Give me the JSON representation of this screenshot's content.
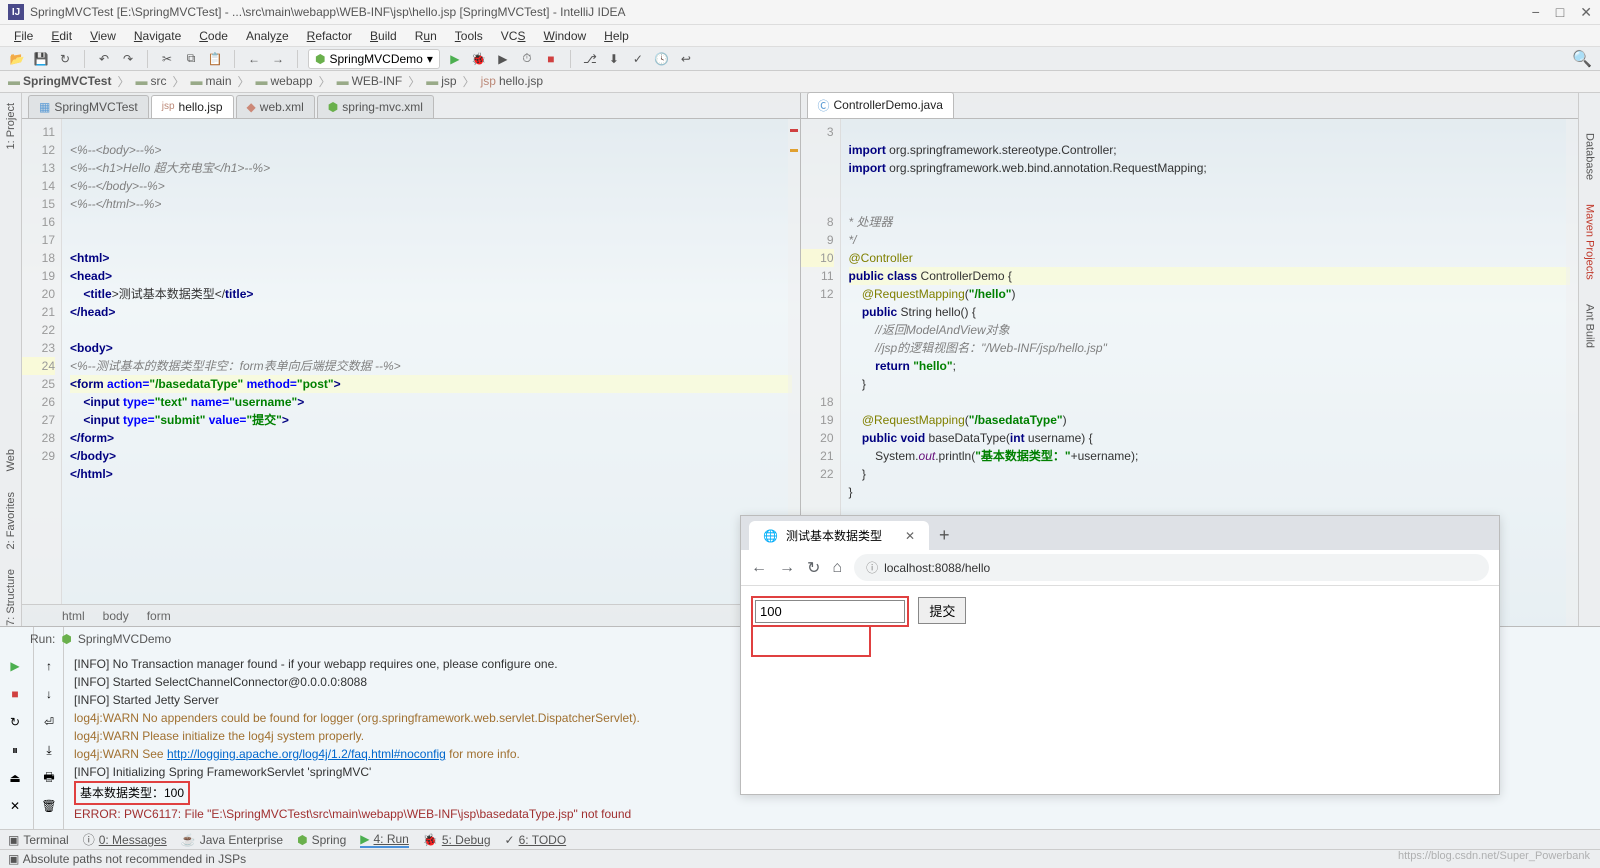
{
  "titlebar": {
    "text": "SpringMVCTest [E:\\SpringMVCTest] - ...\\src\\main\\webapp\\WEB-INF\\jsp\\hello.jsp [SpringMVCTest] - IntelliJ IDEA"
  },
  "menu": [
    "File",
    "Edit",
    "View",
    "Navigate",
    "Code",
    "Analyze",
    "Refactor",
    "Build",
    "Run",
    "Tools",
    "VCS",
    "Window",
    "Help"
  ],
  "run_config": "SpringMVCDemo",
  "breadcrumbs": [
    "SpringMVCTest",
    "src",
    "main",
    "webapp",
    "WEB-INF",
    "jsp",
    "hello.jsp"
  ],
  "left_tabs": [
    {
      "label": "SpringMVCTest",
      "active": false
    },
    {
      "label": "hello.jsp",
      "active": true
    },
    {
      "label": "web.xml",
      "active": false
    },
    {
      "label": "spring-mvc.xml",
      "active": false
    }
  ],
  "right_tabs": [
    {
      "label": "ControllerDemo.java",
      "active": true
    }
  ],
  "left_rail": [
    "1: Project",
    "Web",
    "2: Favorites",
    "7: Structure"
  ],
  "right_rail": [
    "Database",
    "Maven Projects",
    "Ant Build"
  ],
  "left_gutter": [
    "11",
    "12",
    "13",
    "14",
    "15",
    "16",
    "17",
    "18",
    "19",
    "20",
    "21",
    "22",
    "23",
    "24",
    "25",
    "26",
    "27",
    "28",
    "29"
  ],
  "right_gutter": [
    "3",
    "",
    "",
    "",
    "",
    "8",
    "9",
    "10",
    "11",
    "12",
    "",
    "",
    "",
    "",
    "",
    "18",
    "19",
    "20",
    "21",
    "22"
  ],
  "crumbs_bottom": [
    "html",
    "body",
    "form"
  ],
  "run": {
    "label": "Run:",
    "config": "SpringMVCDemo",
    "lines": {
      "l1": "[INFO] No Transaction manager found - if your webapp requires one, please configure one.",
      "l2": "[INFO] Started SelectChannelConnector@0.0.0.0:8088",
      "l3": "[INFO] Started Jetty Server",
      "l4": "log4j:WARN No appenders could be found for logger (org.springframework.web.servlet.DispatcherServlet).",
      "l5": "log4j:WARN Please initialize the log4j system properly.",
      "l6a": "log4j:WARN See ",
      "l6b": "http://logging.apache.org/log4j/1.2/faq.html#noconfig",
      "l6c": " for more info.",
      "l7": "[INFO] Initializing Spring FrameworkServlet 'springMVC'",
      "l8": "基本数据类型：100",
      "l9": "ERROR: PWC6117: File \"E:\\SpringMVCTest\\src\\main\\webapp\\WEB-INF\\jsp\\basedataType.jsp\" not found"
    }
  },
  "bottom_tabs": [
    "Terminal",
    "0: Messages",
    "Java Enterprise",
    "Spring",
    "4: Run",
    "5: Debug",
    "6: TODO"
  ],
  "statusbar": "Absolute paths not recommended in JSPs",
  "browser": {
    "tab_title": "测试基本数据类型",
    "url": "localhost:8088/hello",
    "input_value": "100",
    "submit_label": "提交"
  },
  "left_code": {
    "c11": "<%--<body>--%>",
    "c12": "<%--<h1>Hello 超大充电宝</h1>--%>",
    "c13": "<%--</body>--%>",
    "c14": "<%--</html>--%>",
    "c17_open": "<",
    "c17_tag": "html",
    "c17_close": ">",
    "c18_open": "<",
    "c18_tag": "head",
    "c18_close": ">",
    "c19_open": "    <",
    "c19_tag": "title",
    "c19_mid": ">测试基本数据类型</",
    "c19_tag2": "title",
    "c19_close": ">",
    "c20_open": "</",
    "c20_tag": "head",
    "c20_close": ">",
    "c22_open": "<",
    "c22_tag": "body",
    "c22_close": ">",
    "c23": "<%--测试基本的数据类型非空：form表单向后端提交数据 --%>",
    "c24_open": "<",
    "c24_tag": "form ",
    "c24_a1": "action=",
    "c24_v1": "\"/basedataType\"",
    "c24_a2": " method=",
    "c24_v2": "\"post\"",
    "c24_close": ">",
    "c25_open": "    <",
    "c25_tag": "input ",
    "c25_a1": "type=",
    "c25_v1": "\"text\"",
    "c25_a2": " name=",
    "c25_v2": "\"username\"",
    "c25_close": ">",
    "c26_open": "    <",
    "c26_tag": "input ",
    "c26_a1": "type=",
    "c26_v1": "\"submit\"",
    "c26_a2": " value=",
    "c26_v2": "\"提交\"",
    "c26_close": ">",
    "c27_open": "</",
    "c27_tag": "form",
    "c27_close": ">",
    "c28_open": "</",
    "c28_tag": "body",
    "c28_close": ">",
    "c29_open": "</",
    "c29_tag": "html",
    "c29_close": ">"
  },
  "right_code": {
    "r3a": "import ",
    "r3b": "org.springframework.stereotype.",
    "r3c": "Controller",
    "r3d": ";",
    "r4a": "import ",
    "r4b": "org.springframework.web.bind.annotation.",
    "r4c": "RequestMapping",
    "r4d": ";",
    "r8": "* 处理器",
    "r9": "*/",
    "r10": "@Controller",
    "r11a": "public class ",
    "r11b": "ControllerDemo {",
    "r12a": "    @RequestMapping",
    "r12b": "(",
    "r12c": "\"/hello\"",
    "r12d": ")",
    "r13a": "    public ",
    "r13b": "String hello() {",
    "r14": "        //返回ModelAndView对象",
    "r15": "        //jsp的逻辑视图名：\"/Web-INF/jsp/hello.jsp\"",
    "r16a": "        return ",
    "r16b": "\"hello\"",
    "r16c": ";",
    "r17": "    }",
    "r19a": "    @RequestMapping",
    "r19b": "(",
    "r19c": "\"/basedataType\"",
    "r19d": ")",
    "r20a": "    public void ",
    "r20b": "baseDataType(",
    "r20c": "int ",
    "r20d": "username) {",
    "r21a": "        System.",
    "r21b": "out",
    "r21c": ".println(",
    "r21d": "\"基本数据类型：\"",
    "r21e": "+username);",
    "r22": "    }",
    "r23": "}"
  },
  "watermark": "https://blog.csdn.net/Super_Powerbank"
}
